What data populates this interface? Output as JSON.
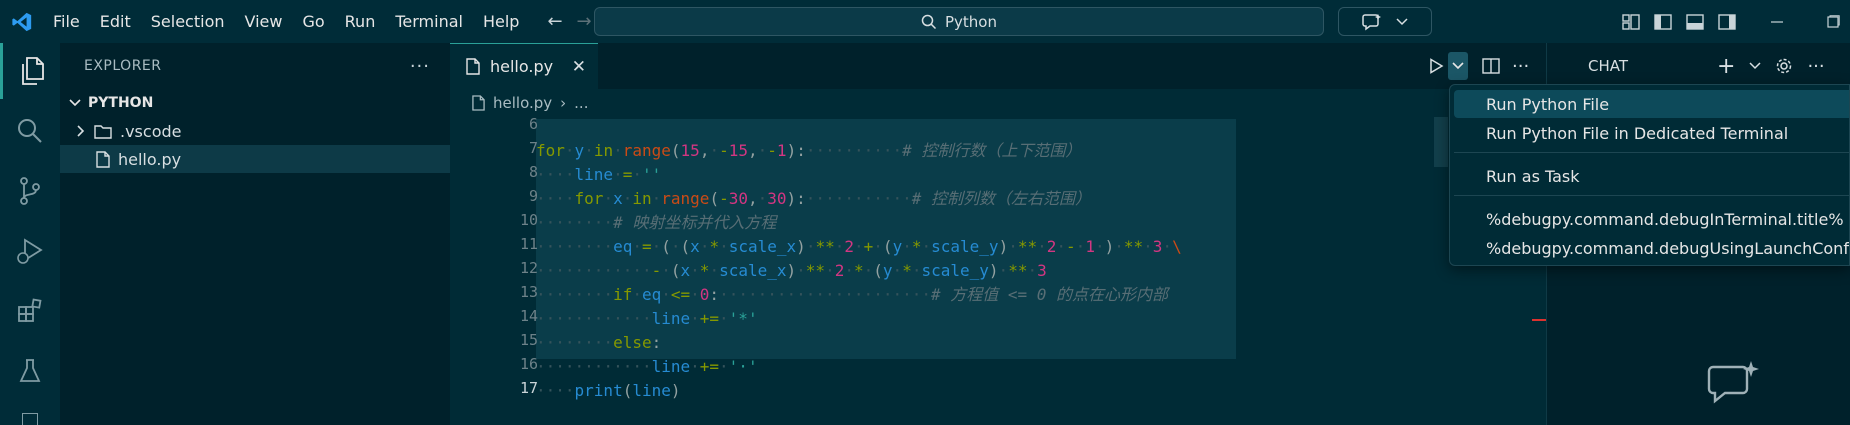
{
  "menu": [
    "File",
    "Edit",
    "Selection",
    "View",
    "Go",
    "Run",
    "Terminal",
    "Help"
  ],
  "search": {
    "label": "Python"
  },
  "sidebar": {
    "title": "EXPLORER",
    "section": "PYTHON",
    "items": [
      {
        "label": ".vscode",
        "type": "folder"
      },
      {
        "label": "hello.py",
        "type": "file"
      }
    ]
  },
  "editor": {
    "tab_label": "hello.py",
    "breadcrumb_file": "hello.py",
    "breadcrumb_more": "...",
    "line_numbers": [
      "6",
      "7",
      "8",
      "9",
      "10",
      "11",
      "12",
      "13",
      "14",
      "15",
      "16",
      "17"
    ],
    "comments": {
      "l7": "# 控制行数（上下范围）",
      "l9": "# 控制列数（左右范围）",
      "l10": "# 映射坐标并代入方程",
      "l13": "# 方程值 <= 0 的点在心形内部"
    }
  },
  "run_menu": {
    "items": [
      "Run Python File",
      "Run Python File in Dedicated Terminal",
      "Run as Task",
      "%debugpy.command.debugInTerminal.title%",
      "%debugpy.command.debugUsingLaunchConfig.title%"
    ]
  },
  "chat": {
    "title": "CHAT"
  },
  "colors": {
    "accent": "#2aa198",
    "keyword": "#859900",
    "variable": "#268bd2",
    "function": "#cb4b16",
    "number": "#d33682",
    "comment": "#586e75"
  }
}
